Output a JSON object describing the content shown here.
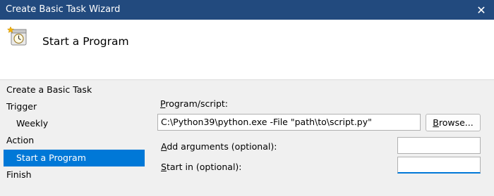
{
  "window": {
    "title": "Create Basic Task Wizard",
    "close_glyph": "✕"
  },
  "header": {
    "icon": "scheduled-task-clock-icon",
    "heading": "Start a Program"
  },
  "steps": [
    {
      "label": "Create a Basic Task"
    },
    {
      "label": "Trigger"
    },
    {
      "label": "Weekly"
    },
    {
      "label": "Action"
    },
    {
      "label": "Start a Program",
      "selected": true
    },
    {
      "label": "Finish"
    }
  ],
  "form": {
    "program_label_ul": "P",
    "program_label_rest": "rogram/script:",
    "program_value": "C:\\Python39\\python.exe -File \"path\\to\\script.py\"",
    "browse_ul": "B",
    "browse_rest": "rowse...",
    "args_label_ul": "A",
    "args_label_rest": "dd arguments (optional):",
    "args_value": "",
    "startin_label_ul": "S",
    "startin_label_rest": "tart in (optional):",
    "startin_value": ""
  },
  "colors": {
    "titlebar": "#224a7e",
    "selection": "#0078d7",
    "content_bg": "#f0f0f0",
    "header_bg": "#ffffff"
  }
}
